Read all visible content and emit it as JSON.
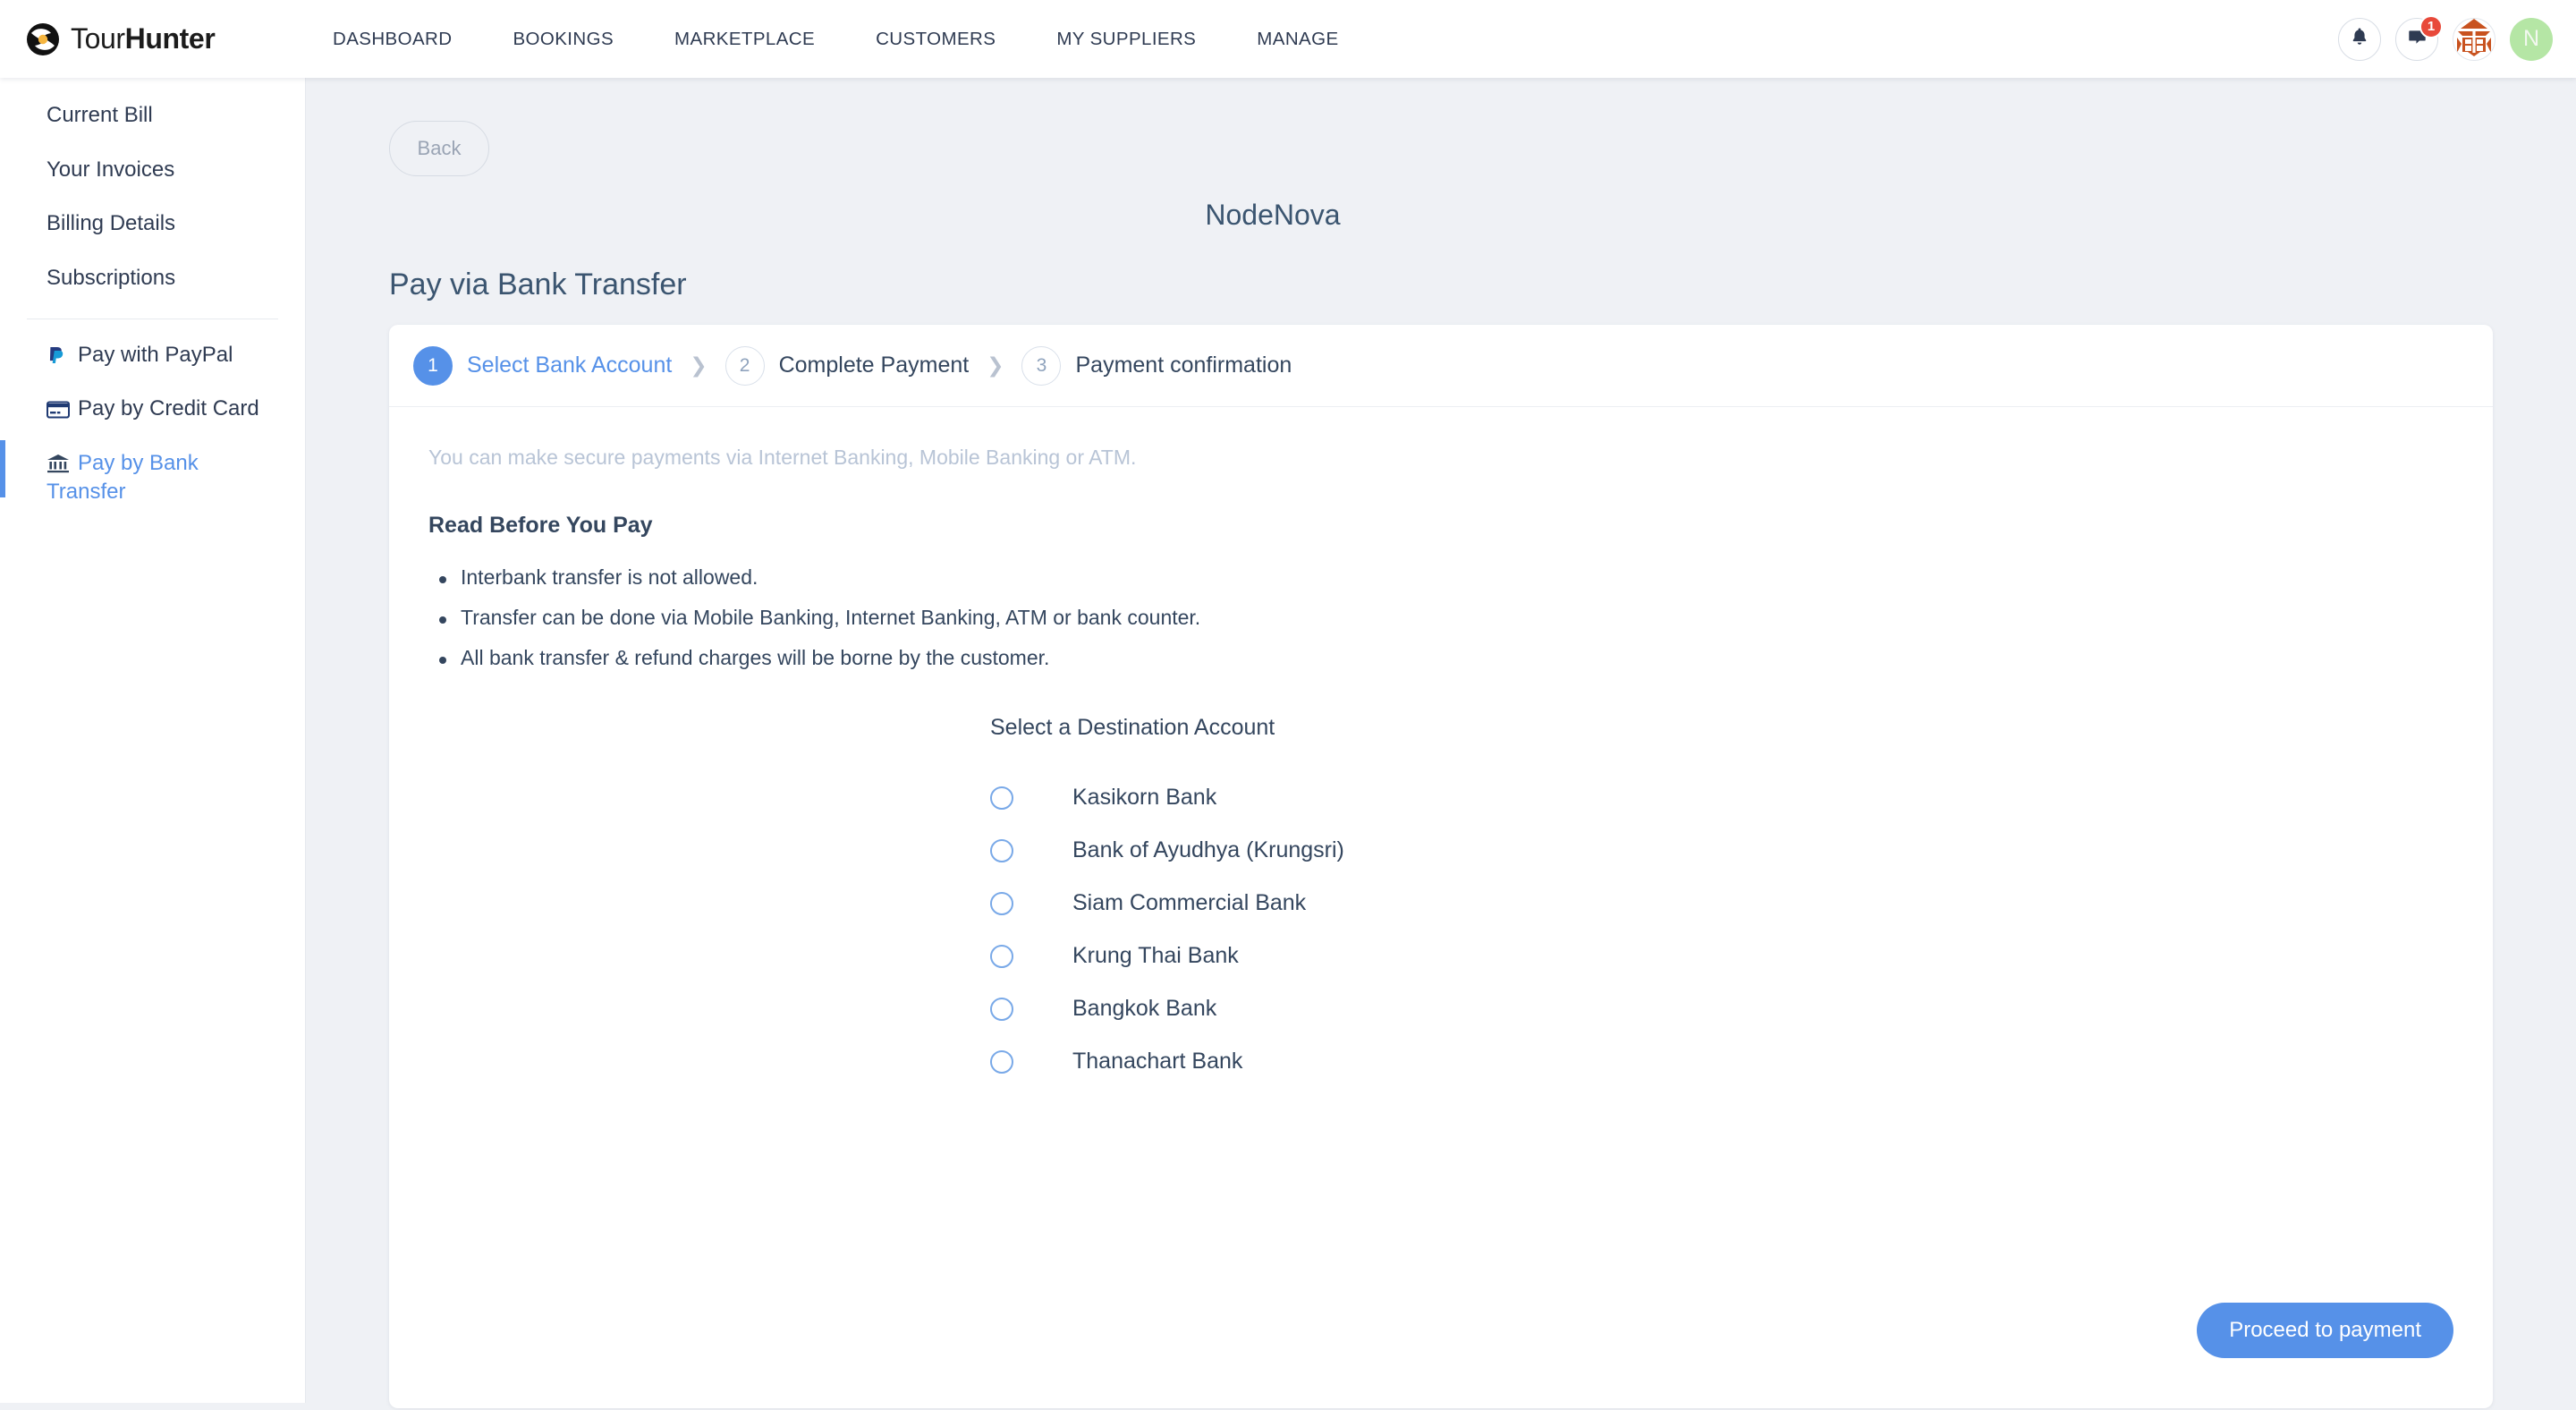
{
  "header": {
    "brand": {
      "word1": "Tour",
      "word2": "Hunter"
    },
    "nav": [
      {
        "label": "DASHBOARD"
      },
      {
        "label": "BOOKINGS"
      },
      {
        "label": "MARKETPLACE"
      },
      {
        "label": "CUSTOMERS"
      },
      {
        "label": "MY SUPPLIERS"
      },
      {
        "label": "MANAGE"
      }
    ],
    "notifications_icon": "bell-icon",
    "messages_icon": "chat-icon",
    "messages_badge": "1",
    "org_icon": "pagoda-logo-icon",
    "avatar_initial": "N"
  },
  "sidebar": {
    "items": [
      {
        "label": "Current Bill",
        "icon": null,
        "active": false
      },
      {
        "label": "Your Invoices",
        "icon": null,
        "active": false
      },
      {
        "label": "Billing Details",
        "icon": null,
        "active": false
      },
      {
        "label": "Subscriptions",
        "icon": null,
        "active": false
      }
    ],
    "payment_items": [
      {
        "label": "Pay with PayPal",
        "icon": "paypal-icon",
        "active": false
      },
      {
        "label": "Pay by Credit Card",
        "icon": "credit-card-icon",
        "active": false
      },
      {
        "label": "Pay by Bank Transfer",
        "icon": "bank-icon",
        "active": true
      }
    ]
  },
  "main": {
    "back_label": "Back",
    "merchant": "NodeNova",
    "page_title": "Pay via Bank Transfer",
    "steps": [
      {
        "num": "1",
        "label": "Select Bank Account",
        "current": true
      },
      {
        "num": "2",
        "label": "Complete Payment",
        "current": false
      },
      {
        "num": "3",
        "label": "Payment confirmation",
        "current": false
      }
    ],
    "step_separator": "❯",
    "note": "You can make secure payments via Internet Banking, Mobile Banking or ATM.",
    "read_title": "Read Before You Pay",
    "rules": [
      "Interbank transfer is not allowed.",
      "Transfer can be done via Mobile Banking, Internet Banking, ATM or bank counter.",
      "All bank transfer & refund charges will be borne by the customer."
    ],
    "select_title": "Select a Destination Account",
    "banks": [
      {
        "label": "Kasikorn Bank",
        "selected": false
      },
      {
        "label": "Bank of Ayudhya (Krungsri)",
        "selected": false
      },
      {
        "label": "Siam Commercial Bank",
        "selected": false
      },
      {
        "label": "Krung Thai Bank",
        "selected": false
      },
      {
        "label": "Bangkok Bank",
        "selected": false
      },
      {
        "label": "Thanachart Bank",
        "selected": false
      }
    ],
    "proceed_label": "Proceed to payment"
  },
  "colors": {
    "accent": "#5691e8",
    "page_bg": "#eff1f5",
    "text": "#34465e",
    "muted": "#b8c4d6",
    "badge": "#e8493a",
    "avatar_bg": "#b5e6a5",
    "org_orange": "#c8521f"
  }
}
